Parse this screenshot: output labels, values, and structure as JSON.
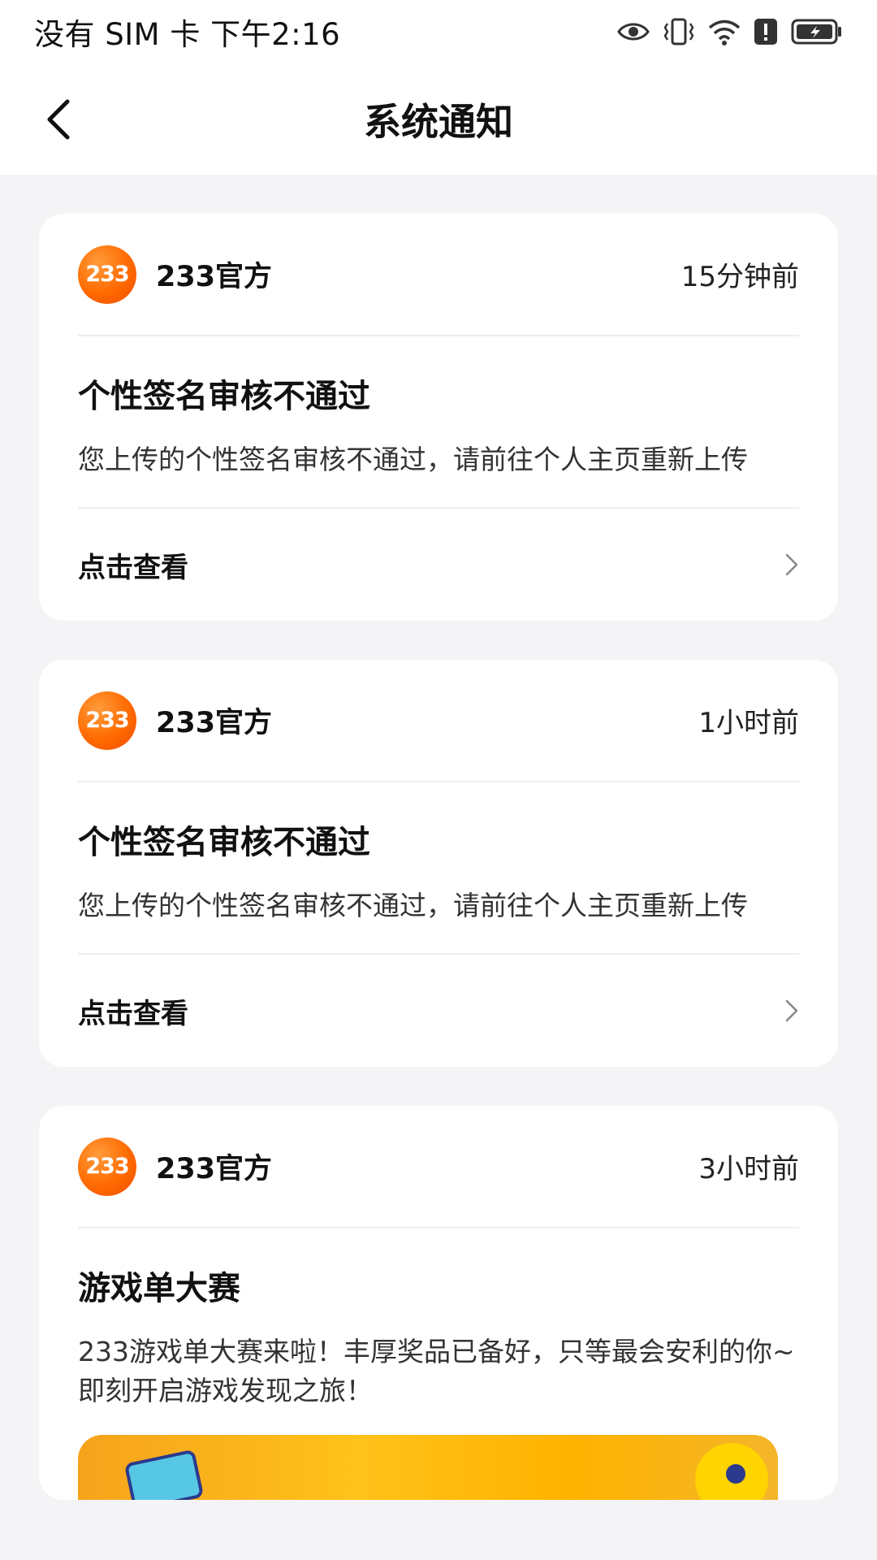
{
  "statusbar": {
    "carrier_time": "没有 SIM 卡 下午2:16",
    "icons": [
      "eye-icon",
      "vibrate-icon",
      "wifi-icon",
      "alert-icon",
      "battery-charging-icon"
    ]
  },
  "nav": {
    "title": "系统通知"
  },
  "notifications": [
    {
      "sender": "233官方",
      "avatar_text": "233",
      "time": "15分钟前",
      "title": "个性签名审核不通过",
      "content": "您上传的个性签名审核不通过，请前往个人主页重新上传",
      "action": "点击查看"
    },
    {
      "sender": "233官方",
      "avatar_text": "233",
      "time": "1小时前",
      "title": "个性签名审核不通过",
      "content": "您上传的个性签名审核不通过，请前往个人主页重新上传",
      "action": "点击查看"
    },
    {
      "sender": "233官方",
      "avatar_text": "233",
      "time": "3小时前",
      "title": "游戏单大赛",
      "content": "233游戏单大赛来啦！丰厚奖品已备好，只等最会安利的你~即刻开启游戏发现之旅！"
    }
  ],
  "colors": {
    "accent": "#ff6a00",
    "background": "#f4f4f6",
    "card": "#ffffff",
    "banner": "#ffc21a"
  }
}
